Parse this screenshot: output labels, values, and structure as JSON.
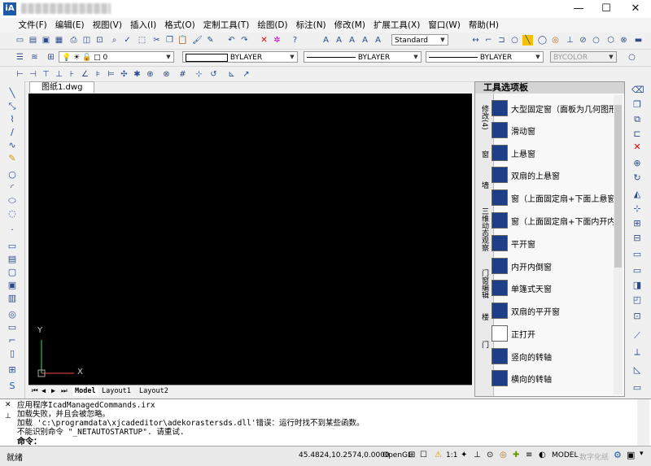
{
  "window": {
    "app_icon_text": "iA",
    "minimize": "—",
    "maximize": "☐",
    "close": "✕"
  },
  "menu": [
    "文件(F)",
    "编辑(E)",
    "视图(V)",
    "插入(I)",
    "格式(O)",
    "定制工具(T)",
    "绘图(D)",
    "标注(N)",
    "修改(M)",
    "扩展工具(X)",
    "窗口(W)",
    "帮助(H)"
  ],
  "toolbar": {
    "text_style": "Standard",
    "layer": "0",
    "color": "BYLAYER",
    "linetype": "BYLAYER",
    "lineweight": "BYLAYER",
    "plotstyle": "BYCOLOR"
  },
  "document": {
    "tab_name": "图纸1.dwg",
    "tab_close": "✕"
  },
  "canvas": {
    "axis_y": "Y",
    "axis_x": "X"
  },
  "layouts": [
    "Model",
    "Layout1",
    "Layout2"
  ],
  "palette": {
    "title": "工具选项板",
    "tabs": [
      "修改(4)",
      "窗",
      "墙",
      "三维动态观察",
      "门窗编辑",
      "楼",
      "门"
    ],
    "items": [
      "大型固定窗（面板为几何图形）",
      "滑动窗",
      "上悬窗",
      "双扇的上悬窗",
      "窗（上面固定扇+下面上悬窗）",
      "窗（上面固定扇+下面内开内",
      "平开窗",
      "内开内倒窗",
      "单篷式天窗",
      "双扇的平开窗",
      "正打开",
      "竖向的转轴",
      "横向的转轴"
    ]
  },
  "command": {
    "lines": [
      "应用程序IcadManagedCommands.irx",
      "加载失败，并且会被忽略。",
      "加载 'c:\\programdata\\xjcadeditor\\adekorastersds.dll'错误：运行时找不到某些函数。",
      "不能识别命令 \"_NETAUTOSTARTUP\". 请重试."
    ],
    "prompt": "命令："
  },
  "status": {
    "ready": "就绪",
    "coords": "45.4824,10.2574,0.0000",
    "opengl": "OpenGL",
    "scale": "1:1",
    "model": "MODEL",
    "watermark": "数字化纸"
  }
}
